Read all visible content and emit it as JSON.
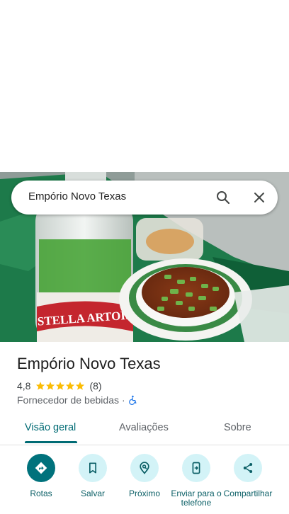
{
  "search": {
    "query": "Empório Novo Texas"
  },
  "place": {
    "name": "Empório Novo Texas",
    "rating": "4,8",
    "stars": 5,
    "review_count": "(8)",
    "category": "Fornecedor de bebidas",
    "separator": "·"
  },
  "tabs": [
    {
      "label": "Visão geral"
    },
    {
      "label": "Avaliações"
    },
    {
      "label": "Sobre"
    }
  ],
  "actions": [
    {
      "label": "Rotas"
    },
    {
      "label": "Salvar"
    },
    {
      "label": "Próximo"
    },
    {
      "label": "Enviar para o telefone"
    },
    {
      "label": "Compartilhar"
    }
  ],
  "photo": {
    "bottle_label": "STELLA ARTOIS"
  },
  "colors": {
    "accent": "#006b74",
    "action_bg": "#d3f3f7",
    "primary_action_bg": "#00727c",
    "star": "#fbbc04"
  }
}
